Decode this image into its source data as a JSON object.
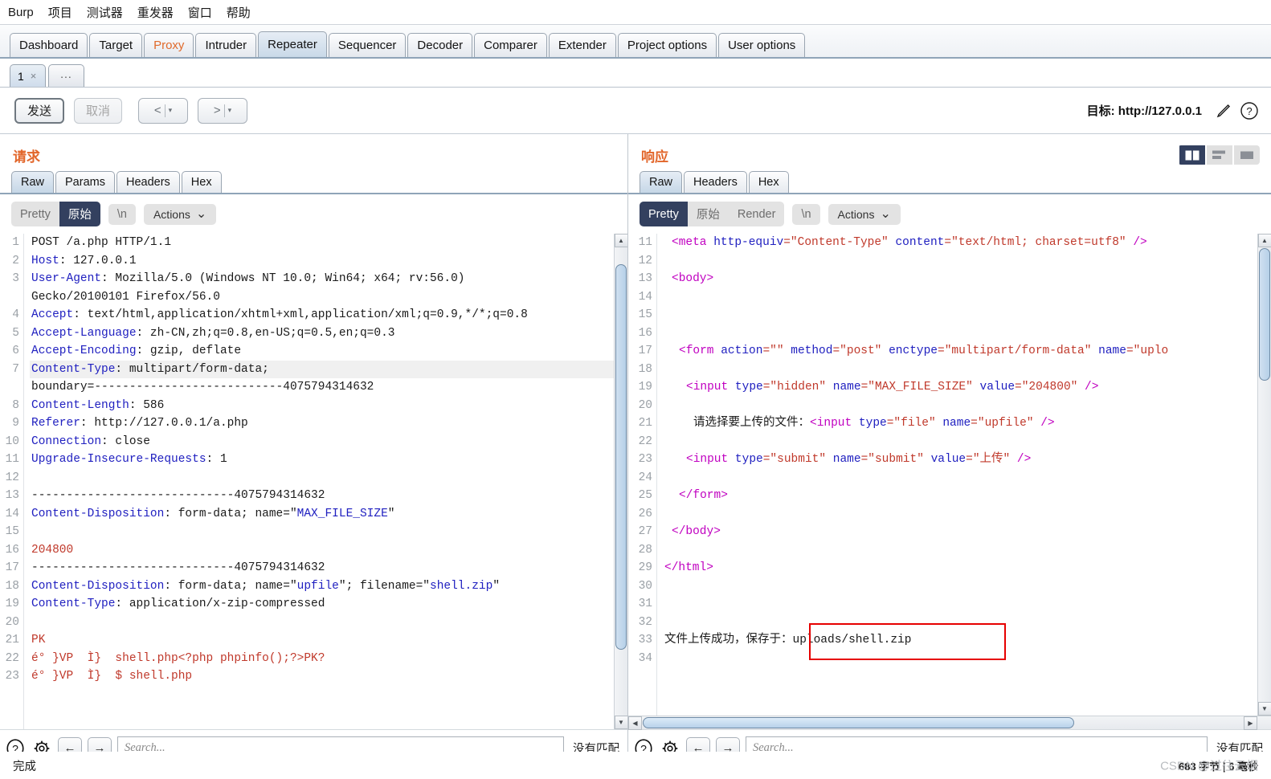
{
  "menubar": [
    {
      "label": "Burp"
    },
    {
      "label": "项目"
    },
    {
      "label": "测试器"
    },
    {
      "label": "重发器"
    },
    {
      "label": "窗口"
    },
    {
      "label": "帮助"
    }
  ],
  "main_tabs": [
    {
      "label": "Dashboard",
      "state": "normal"
    },
    {
      "label": "Target",
      "state": "normal"
    },
    {
      "label": "Proxy",
      "state": "highlight"
    },
    {
      "label": "Intruder",
      "state": "normal"
    },
    {
      "label": "Repeater",
      "state": "active"
    },
    {
      "label": "Sequencer",
      "state": "normal"
    },
    {
      "label": "Decoder",
      "state": "normal"
    },
    {
      "label": "Comparer",
      "state": "normal"
    },
    {
      "label": "Extender",
      "state": "normal"
    },
    {
      "label": "Project options",
      "state": "normal"
    },
    {
      "label": "User options",
      "state": "normal"
    }
  ],
  "repeater_tabs": {
    "items": [
      {
        "label": "1",
        "close": "×"
      }
    ],
    "add_label": "..."
  },
  "toolbar": {
    "send_label": "发送",
    "cancel_label": "取消",
    "prev_label": "<",
    "next_label": ">",
    "caret": "▾",
    "target_label": "目标: http://127.0.0.1",
    "edit_icon": "pencil-icon",
    "help_icon": "help-icon"
  },
  "request_pane": {
    "title": "请求",
    "tabs": [
      {
        "label": "Raw",
        "active": true
      },
      {
        "label": "Params",
        "active": false
      },
      {
        "label": "Headers",
        "active": false
      },
      {
        "label": "Hex",
        "active": false
      }
    ],
    "format": {
      "pretty": "Pretty",
      "raw": "原始",
      "newline": "\\n",
      "actions": "Actions",
      "actions_caret": "⌄",
      "selected": "原始"
    },
    "lines": [
      {
        "n": "1",
        "highlight": false,
        "parts": [
          {
            "t": "POST /a.php HTTP/1.1",
            "c": "k-plain"
          }
        ]
      },
      {
        "n": "2",
        "highlight": false,
        "parts": [
          {
            "t": "Host",
            "c": "k-hdr"
          },
          {
            "t": ": 127.0.0.1",
            "c": "k-plain"
          }
        ]
      },
      {
        "n": "3",
        "highlight": false,
        "parts": [
          {
            "t": "User-Agent",
            "c": "k-hdr"
          },
          {
            "t": ": Mozilla/5.0 (Windows NT 10.0; Win64; x64; rv:56.0)",
            "c": "k-plain"
          }
        ]
      },
      {
        "n": "",
        "highlight": false,
        "parts": [
          {
            "t": "Gecko/20100101 Firefox/56.0",
            "c": "k-plain"
          }
        ]
      },
      {
        "n": "4",
        "highlight": false,
        "parts": [
          {
            "t": "Accept",
            "c": "k-hdr"
          },
          {
            "t": ": text/html,application/xhtml+xml,application/xml;q=0.9,*/*;q=0.8",
            "c": "k-plain"
          }
        ]
      },
      {
        "n": "5",
        "highlight": false,
        "parts": [
          {
            "t": "Accept-Language",
            "c": "k-hdr"
          },
          {
            "t": ": zh-CN,zh;q=0.8,en-US;q=0.5,en;q=0.3",
            "c": "k-plain"
          }
        ]
      },
      {
        "n": "6",
        "highlight": false,
        "parts": [
          {
            "t": "Accept-Encoding",
            "c": "k-hdr"
          },
          {
            "t": ": gzip, deflate",
            "c": "k-plain"
          }
        ]
      },
      {
        "n": "7",
        "highlight": true,
        "parts": [
          {
            "t": "Content-Type",
            "c": "k-hdr"
          },
          {
            "t": ": multipart/form-data;",
            "c": "k-plain"
          }
        ]
      },
      {
        "n": "",
        "highlight": false,
        "parts": [
          {
            "t": "boundary=---------------------------4075794314632",
            "c": "k-plain"
          }
        ]
      },
      {
        "n": "8",
        "highlight": false,
        "parts": [
          {
            "t": "Content-Length",
            "c": "k-hdr"
          },
          {
            "t": ": 586",
            "c": "k-plain"
          }
        ]
      },
      {
        "n": "9",
        "highlight": false,
        "parts": [
          {
            "t": "Referer",
            "c": "k-hdr"
          },
          {
            "t": ": http://127.0.0.1/a.php",
            "c": "k-plain"
          }
        ]
      },
      {
        "n": "10",
        "highlight": false,
        "parts": [
          {
            "t": "Connection",
            "c": "k-hdr"
          },
          {
            "t": ": close",
            "c": "k-plain"
          }
        ]
      },
      {
        "n": "11",
        "highlight": false,
        "parts": [
          {
            "t": "Upgrade-Insecure-Requests",
            "c": "k-hdr"
          },
          {
            "t": ": 1",
            "c": "k-plain"
          }
        ]
      },
      {
        "n": "12",
        "highlight": false,
        "parts": [
          {
            "t": "",
            "c": "k-plain"
          }
        ]
      },
      {
        "n": "13",
        "highlight": false,
        "parts": [
          {
            "t": "-----------------------------4075794314632",
            "c": "k-plain"
          }
        ]
      },
      {
        "n": "14",
        "highlight": false,
        "parts": [
          {
            "t": "Content-Disposition",
            "c": "k-hdr"
          },
          {
            "t": ": form-data; name=″",
            "c": "k-plain"
          },
          {
            "t": "MAX_FILE_SIZE",
            "c": "k-str"
          },
          {
            "t": "″",
            "c": "k-plain"
          }
        ]
      },
      {
        "n": "15",
        "highlight": false,
        "parts": [
          {
            "t": "",
            "c": "k-plain"
          }
        ]
      },
      {
        "n": "16",
        "highlight": false,
        "parts": [
          {
            "t": "204800",
            "c": "k-red"
          }
        ]
      },
      {
        "n": "17",
        "highlight": false,
        "parts": [
          {
            "t": "-----------------------------4075794314632",
            "c": "k-plain"
          }
        ]
      },
      {
        "n": "18",
        "highlight": false,
        "parts": [
          {
            "t": "Content-Disposition",
            "c": "k-hdr"
          },
          {
            "t": ": form-data; name=″",
            "c": "k-plain"
          },
          {
            "t": "upfile",
            "c": "k-str"
          },
          {
            "t": "″; filename=″",
            "c": "k-plain"
          },
          {
            "t": "shell.zip",
            "c": "k-str"
          },
          {
            "t": "″",
            "c": "k-plain"
          }
        ]
      },
      {
        "n": "19",
        "highlight": false,
        "parts": [
          {
            "t": "Content-Type",
            "c": "k-hdr"
          },
          {
            "t": ": application/x-zip-compressed",
            "c": "k-plain"
          }
        ]
      },
      {
        "n": "20",
        "highlight": false,
        "parts": [
          {
            "t": "",
            "c": "k-plain"
          }
        ]
      },
      {
        "n": "21",
        "highlight": false,
        "parts": [
          {
            "t": "PK",
            "c": "k-red"
          }
        ]
      },
      {
        "n": "22",
        "highlight": false,
        "parts": [
          {
            "t": "é° }VP  Ì}  shell.php<?php phpinfo();?>PK?",
            "c": "k-red"
          }
        ]
      },
      {
        "n": "23",
        "highlight": false,
        "parts": [
          {
            "t": "é° }VP  Ì}  $ shell.php",
            "c": "k-red"
          }
        ]
      }
    ],
    "search": {
      "placeholder": "Search...",
      "value": "",
      "result": "没有匹配",
      "help_icon": "help-icon",
      "settings_icon": "gear-icon",
      "prev_icon": "arrow-left-icon",
      "next_icon": "arrow-right-icon"
    }
  },
  "response_pane": {
    "title": "响应",
    "tabs": [
      {
        "label": "Raw",
        "active": true
      },
      {
        "label": "Headers",
        "active": false
      },
      {
        "label": "Hex",
        "active": false
      }
    ],
    "format": {
      "pretty": "Pretty",
      "raw": "原始",
      "render": "Render",
      "newline": "\\n",
      "actions": "Actions",
      "actions_caret": "⌄",
      "selected": "Pretty"
    },
    "layout_modes": [
      {
        "name": "side-by-side",
        "active": true
      },
      {
        "name": "stacked",
        "active": false
      },
      {
        "name": "single",
        "active": false
      }
    ],
    "lines": [
      {
        "n": "11",
        "indent": 1,
        "parts": [
          {
            "t": "<",
            "c": "k-tag"
          },
          {
            "t": "meta",
            "c": "k-tag"
          },
          {
            "t": " http-equiv",
            "c": "k-attr"
          },
          {
            "t": "=″Content-Type″",
            "c": "k-aval"
          },
          {
            "t": " content",
            "c": "k-attr"
          },
          {
            "t": "=″text/html; charset=utf8″",
            "c": "k-aval"
          },
          {
            "t": " />",
            "c": "k-tag"
          }
        ]
      },
      {
        "n": "12",
        "indent": 0,
        "parts": []
      },
      {
        "n": "13",
        "indent": 1,
        "parts": [
          {
            "t": "<body>",
            "c": "k-tag"
          }
        ]
      },
      {
        "n": "14",
        "indent": 0,
        "parts": []
      },
      {
        "n": "15",
        "indent": 0,
        "parts": []
      },
      {
        "n": "16",
        "indent": 0,
        "parts": []
      },
      {
        "n": "17",
        "indent": 2,
        "parts": [
          {
            "t": "<form",
            "c": "k-tag"
          },
          {
            "t": " action",
            "c": "k-attr"
          },
          {
            "t": "=″″",
            "c": "k-aval"
          },
          {
            "t": " method",
            "c": "k-attr"
          },
          {
            "t": "=″post″",
            "c": "k-aval"
          },
          {
            "t": " enctype",
            "c": "k-attr"
          },
          {
            "t": "=″multipart/form-data″",
            "c": "k-aval"
          },
          {
            "t": " name",
            "c": "k-attr"
          },
          {
            "t": "=″uplo",
            "c": "k-aval"
          }
        ]
      },
      {
        "n": "18",
        "indent": 0,
        "parts": []
      },
      {
        "n": "19",
        "indent": 3,
        "parts": [
          {
            "t": "<input",
            "c": "k-tag"
          },
          {
            "t": " type",
            "c": "k-attr"
          },
          {
            "t": "=″hidden″",
            "c": "k-aval"
          },
          {
            "t": " name",
            "c": "k-attr"
          },
          {
            "t": "=″MAX_FILE_SIZE″",
            "c": "k-aval"
          },
          {
            "t": " value",
            "c": "k-attr"
          },
          {
            "t": "=″204800″",
            "c": "k-aval"
          },
          {
            "t": " />",
            "c": "k-tag"
          }
        ]
      },
      {
        "n": "20",
        "indent": 0,
        "parts": []
      },
      {
        "n": "21",
        "indent": 4,
        "parts": [
          {
            "t": "请选择要上传的文件：",
            "c": "k-plain"
          },
          {
            "t": "<input",
            "c": "k-tag"
          },
          {
            "t": " type",
            "c": "k-attr"
          },
          {
            "t": "=″file″",
            "c": "k-aval"
          },
          {
            "t": " name",
            "c": "k-attr"
          },
          {
            "t": "=″upfile″",
            "c": "k-aval"
          },
          {
            "t": " />",
            "c": "k-tag"
          }
        ]
      },
      {
        "n": "22",
        "indent": 0,
        "parts": []
      },
      {
        "n": "23",
        "indent": 3,
        "parts": [
          {
            "t": "<input",
            "c": "k-tag"
          },
          {
            "t": " type",
            "c": "k-attr"
          },
          {
            "t": "=″submit″",
            "c": "k-aval"
          },
          {
            "t": " name",
            "c": "k-attr"
          },
          {
            "t": "=″submit″",
            "c": "k-aval"
          },
          {
            "t": " value",
            "c": "k-attr"
          },
          {
            "t": "=″上传″",
            "c": "k-aval"
          },
          {
            "t": " />",
            "c": "k-tag"
          }
        ]
      },
      {
        "n": "24",
        "indent": 0,
        "parts": []
      },
      {
        "n": "25",
        "indent": 2,
        "parts": [
          {
            "t": "</form>",
            "c": "k-tag"
          }
        ]
      },
      {
        "n": "26",
        "indent": 0,
        "parts": []
      },
      {
        "n": "27",
        "indent": 1,
        "parts": [
          {
            "t": "</body>",
            "c": "k-tag"
          }
        ]
      },
      {
        "n": "28",
        "indent": 0,
        "parts": []
      },
      {
        "n": "29",
        "indent": 0,
        "parts": [
          {
            "t": "</html>",
            "c": "k-tag"
          }
        ]
      },
      {
        "n": "30",
        "indent": 0,
        "parts": []
      },
      {
        "n": "31",
        "indent": 0,
        "parts": []
      },
      {
        "n": "32",
        "indent": 0,
        "parts": []
      },
      {
        "n": "33",
        "indent": 0,
        "parts": [
          {
            "t": "文件上传成功，保存于：uploads/shell.zip",
            "c": "k-plain"
          }
        ]
      },
      {
        "n": "34",
        "indent": 0,
        "parts": []
      }
    ],
    "annotation": {
      "text": "uploads/shell.zip",
      "color": "#e60000"
    },
    "search": {
      "placeholder": "Search...",
      "value": "",
      "result": "没有匹配",
      "help_icon": "help-icon",
      "settings_icon": "gear-icon",
      "prev_icon": "arrow-left-icon",
      "next_icon": "arrow-right-icon"
    }
  },
  "statusbar": {
    "left": "完成",
    "meta": "683 字节 | 6 毫秒",
    "watermark": "CSDN @过往云烟"
  },
  "colors": {
    "accent": "#e2662a",
    "selected_seg": "#33405f",
    "annotation": "#e60000",
    "tab_active": "#c9d9e8"
  }
}
